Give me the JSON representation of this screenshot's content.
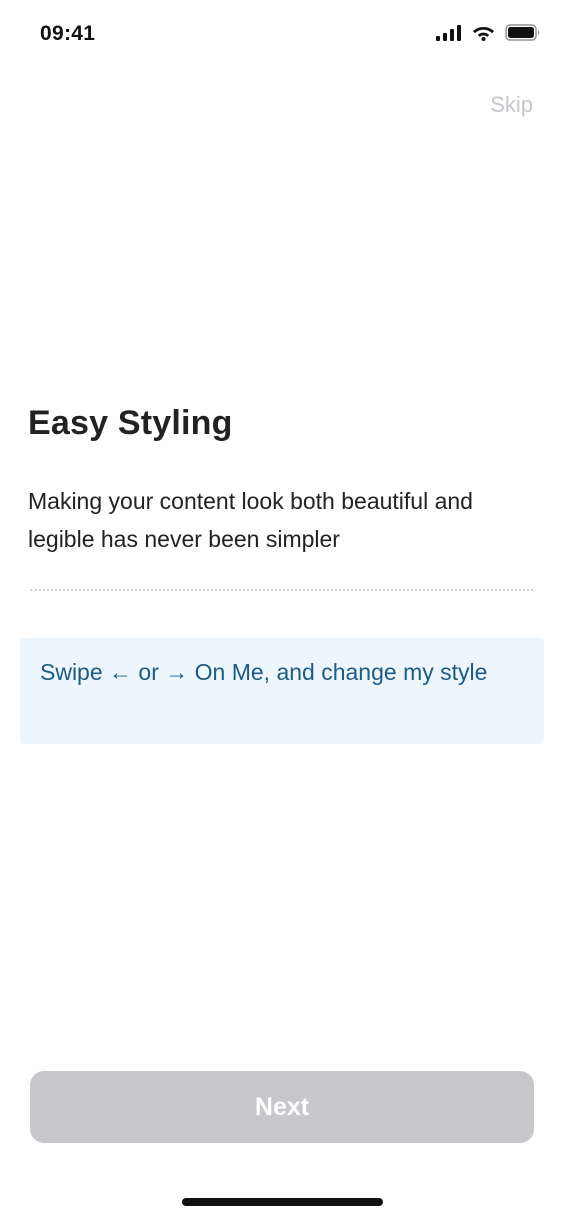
{
  "status_bar": {
    "time": "09:41",
    "icons": [
      "signal-icon",
      "wifi-icon",
      "battery-icon"
    ]
  },
  "header": {
    "skip_label": "Skip"
  },
  "onboarding": {
    "title": "Easy Styling",
    "subtitle": "Making your content look both beautiful and legible has never been simpler",
    "swipe_hint": "Swipe ← or → On Me, and change my style"
  },
  "footer": {
    "next_label": "Next"
  },
  "colors": {
    "background": "#fefefe",
    "text": "#222222",
    "muted": "#c7c7cc",
    "hint_background": "#eef6fd",
    "hint_text": "#1d5b85",
    "button_disabled": "#c8c7cc"
  }
}
